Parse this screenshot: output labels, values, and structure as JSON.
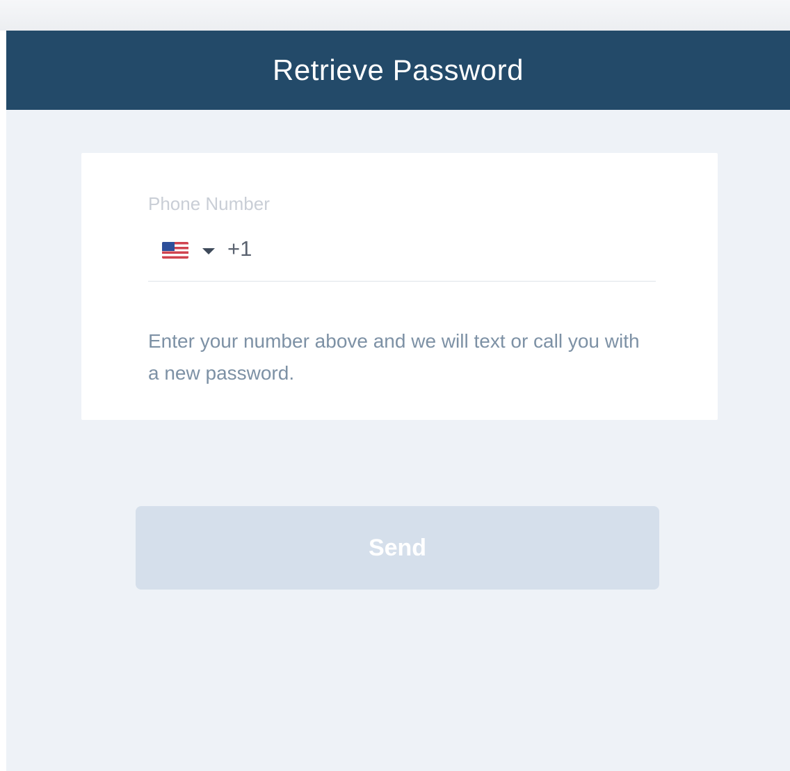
{
  "header": {
    "title": "Retrieve Password"
  },
  "form": {
    "phone_label": "Phone Number",
    "country_flag_icon": "us-flag-icon",
    "dial_code": "+1",
    "phone_value": "",
    "help_text": "Enter your number above and we will text or call you with a new password."
  },
  "actions": {
    "send_label": "Send"
  },
  "colors": {
    "header_bg": "#234a69",
    "page_bg": "#eef2f7",
    "button_disabled_bg": "#d5dfeb",
    "help_text": "#7d91a5"
  }
}
